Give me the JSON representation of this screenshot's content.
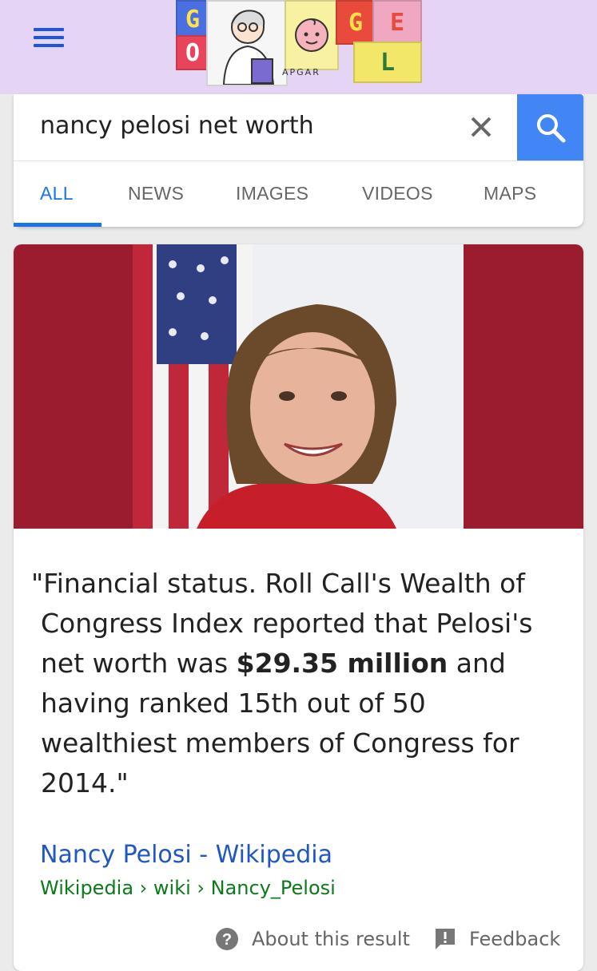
{
  "doodle": {
    "letters": [
      "G",
      "O",
      "G",
      "E",
      "L"
    ],
    "caption": "APGAR"
  },
  "search": {
    "query": "nancy pelosi net worth"
  },
  "tabs": [
    {
      "label": "ALL",
      "active": true
    },
    {
      "label": "NEWS"
    },
    {
      "label": "IMAGES"
    },
    {
      "label": "VIDEOS"
    },
    {
      "label": "MAPS"
    }
  ],
  "result": {
    "snippet_lines": [
      "\"Financial status. Roll Call's Wealth of",
      "Congress Index reported that Pelosi's",
      "net worth was ",
      "$29.35 million",
      " and",
      "having ranked 15th out of 50",
      "wealthiest members of Congress for",
      "2014.\""
    ],
    "source_title": "Nancy Pelosi - Wikipedia",
    "source_url": "Wikipedia › wiki › Nancy_Pelosi",
    "about_label": "About this result",
    "feedback_label": "Feedback"
  },
  "colors": {
    "topbar": "#e6d4f4",
    "accent_blue": "#1a73e8",
    "search_button": "#4285f4",
    "photo_band": "#9b1c2e",
    "url_green": "#0b7a1a"
  }
}
